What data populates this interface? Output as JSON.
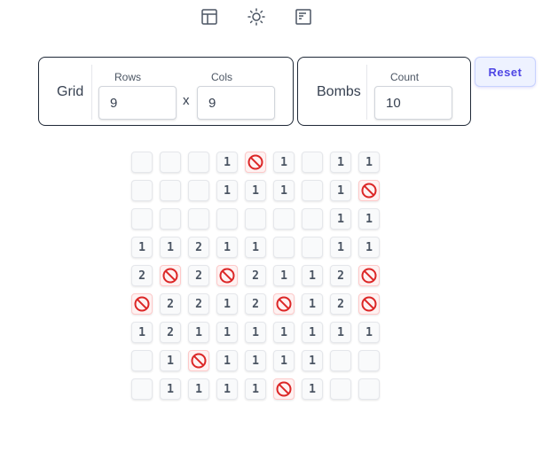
{
  "toolbar": {
    "icons": [
      "layout-icon",
      "sun-icon",
      "panel-icon"
    ]
  },
  "grid_panel": {
    "title": "Grid",
    "rows_label": "Rows",
    "rows_value": "9",
    "times_symbol": "x",
    "cols_label": "Cols",
    "cols_value": "9"
  },
  "bombs_panel": {
    "title": "Bombs",
    "count_label": "Count",
    "count_value": "10"
  },
  "reset_label": "Reset",
  "board": {
    "rows": 9,
    "cols": 9,
    "cells": [
      [
        "",
        "",
        "",
        "1",
        "B",
        "1",
        "",
        "1",
        "1"
      ],
      [
        "",
        "",
        "",
        "1",
        "1",
        "1",
        "",
        "1",
        "B"
      ],
      [
        "",
        "",
        "",
        "",
        "",
        "",
        "",
        "1",
        "1"
      ],
      [
        "1",
        "1",
        "2",
        "1",
        "1",
        "",
        "",
        "1",
        "1"
      ],
      [
        "2",
        "B",
        "2",
        "B",
        "2",
        "1",
        "1",
        "2",
        "B"
      ],
      [
        "B",
        "2",
        "2",
        "1",
        "2",
        "B",
        "1",
        "2",
        "B"
      ],
      [
        "1",
        "2",
        "1",
        "1",
        "1",
        "1",
        "1",
        "1",
        "1"
      ],
      [
        "",
        "1",
        "B",
        "1",
        "1",
        "1",
        "1",
        "",
        ""
      ],
      [
        "",
        "1",
        "1",
        "1",
        "1",
        "B",
        "1",
        "",
        ""
      ]
    ]
  },
  "colors": {
    "bomb": "#dc2626",
    "accent": "#4f46e5",
    "number": "#4b5563"
  }
}
